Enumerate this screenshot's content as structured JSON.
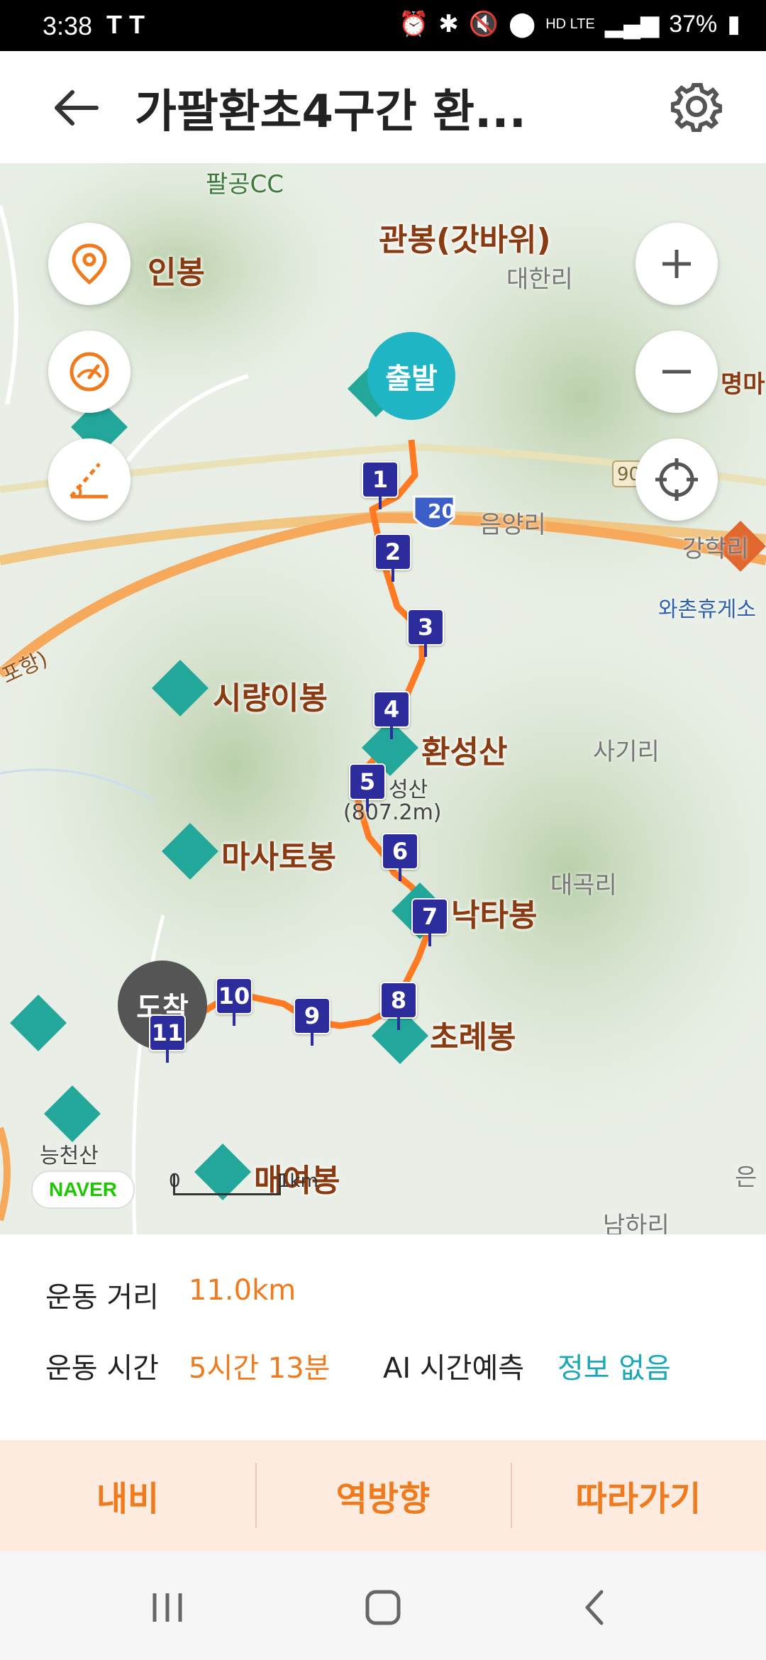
{
  "status_bar": {
    "time": "3:38",
    "carrier_icons": "T T",
    "network": "HD LTE",
    "battery": "37%"
  },
  "header": {
    "title": "가팔환초4구간 환..."
  },
  "map": {
    "start_label": "출발",
    "end_label": "도착",
    "peaks": [
      {
        "name": "인봉"
      },
      {
        "name": "관봉(갓바위)"
      },
      {
        "name": "시량이봉"
      },
      {
        "name": "환성산"
      },
      {
        "name": "마사토봉"
      },
      {
        "name": "낙타봉"
      },
      {
        "name": "초례봉"
      },
      {
        "name": "매여봉"
      }
    ],
    "villages": [
      "팔공CC",
      "대한리",
      "음양리",
      "강학리",
      "사기리",
      "대곡리",
      "남하리",
      "능천산",
      "명마",
      "은"
    ],
    "rest_area": "와촌휴게소",
    "route_label": "포항)",
    "highway_number": "20",
    "road_number": "90",
    "summit_label": "성산",
    "summit_elevation": "(807.2m)",
    "waypoints": [
      "1",
      "2",
      "3",
      "4",
      "5",
      "6",
      "7",
      "8",
      "9",
      "10",
      "11"
    ],
    "naver_label": "NAVER",
    "scale_zero": "0",
    "scale_unit": "1km",
    "accent_color": "#f07a1e",
    "start_color": "#20b5c4"
  },
  "info": {
    "distance_label": "운동 거리",
    "distance_value": "11.0km",
    "time_label": "운동 시간",
    "time_value": "5시간 13분",
    "ai_label": "AI 시간예측",
    "ai_value": "정보 없음"
  },
  "actions": {
    "navi": "내비",
    "reverse": "역방향",
    "follow": "따라가기"
  }
}
